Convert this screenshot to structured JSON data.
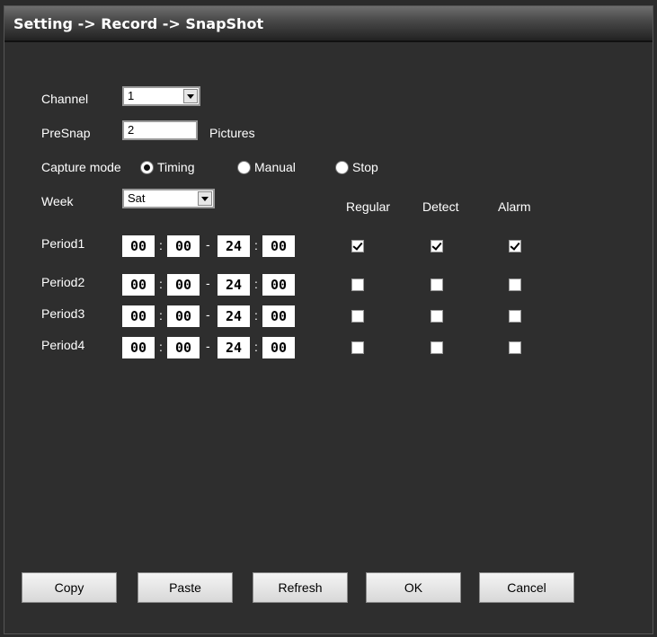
{
  "title": "Setting -> Record -> SnapShot",
  "channel": {
    "label": "Channel",
    "value": "1"
  },
  "presnap": {
    "label": "PreSnap",
    "value": "2",
    "unit": "Pictures"
  },
  "capture_mode": {
    "label": "Capture mode",
    "options": [
      {
        "label": "Timing",
        "selected": true
      },
      {
        "label": "Manual",
        "selected": false
      },
      {
        "label": "Stop",
        "selected": false
      }
    ]
  },
  "week": {
    "label": "Week",
    "value": "Sat"
  },
  "columns": [
    "Regular",
    "Detect",
    "Alarm"
  ],
  "periods": [
    {
      "label": "Period1",
      "start_h": "00",
      "start_m": "00",
      "end_h": "24",
      "end_m": "00",
      "regular": true,
      "detect": true,
      "alarm": true
    },
    {
      "label": "Period2",
      "start_h": "00",
      "start_m": "00",
      "end_h": "24",
      "end_m": "00",
      "regular": false,
      "detect": false,
      "alarm": false
    },
    {
      "label": "Period3",
      "start_h": "00",
      "start_m": "00",
      "end_h": "24",
      "end_m": "00",
      "regular": false,
      "detect": false,
      "alarm": false
    },
    {
      "label": "Period4",
      "start_h": "00",
      "start_m": "00",
      "end_h": "24",
      "end_m": "00",
      "regular": false,
      "detect": false,
      "alarm": false
    }
  ],
  "time_separator": ":",
  "range_separator": "-",
  "buttons": {
    "copy": "Copy",
    "paste": "Paste",
    "refresh": "Refresh",
    "ok": "OK",
    "cancel": "Cancel"
  }
}
